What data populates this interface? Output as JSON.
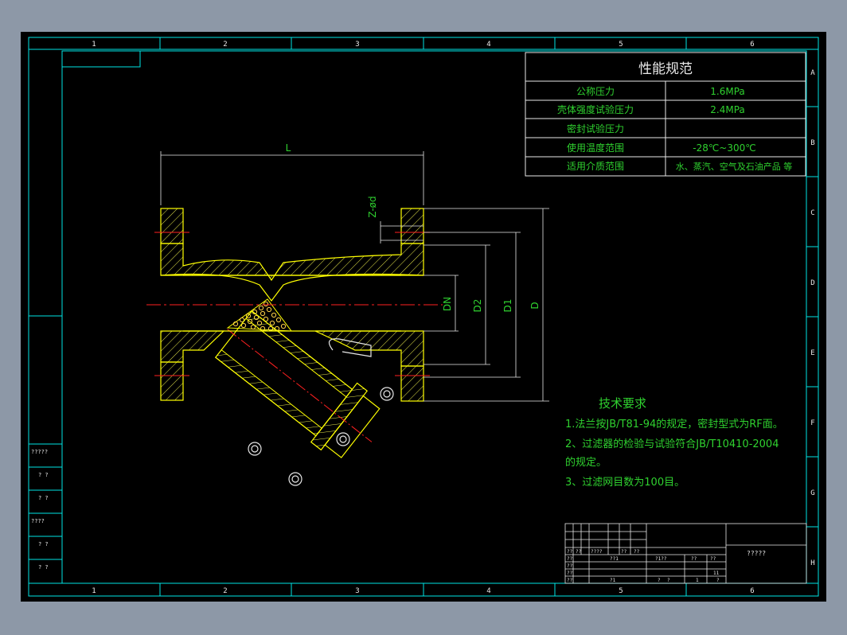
{
  "sheet": {
    "zone_columns": [
      "1",
      "2",
      "3",
      "4",
      "5",
      "6"
    ],
    "zone_rows": [
      "A",
      "B",
      "C",
      "D",
      "E",
      "F",
      "G",
      "H"
    ]
  },
  "performance_table": {
    "title": "性能规范",
    "rows": [
      {
        "label": "公称压力",
        "value": "1.6MPa"
      },
      {
        "label": "壳体强度试验压力",
        "value": "2.4MPa"
      },
      {
        "label": "密封试验压力",
        "value": ""
      },
      {
        "label": "使用温度范围",
        "value": "-28℃~300℃"
      },
      {
        "label": "适用介质范围",
        "value": "水、蒸汽、空气及石油产品 等"
      }
    ]
  },
  "dimensions": {
    "length": "L",
    "bolt_holes": "Z-ød",
    "nominal": "DN",
    "d2": "D2",
    "d1": "D1",
    "d": "D"
  },
  "technical_requirements": {
    "title": "技术要求",
    "items": [
      "1.法兰按JB/T81-94的规定，密封型式为RF面。",
      "2、过滤器的检验与试验符合JB/T10410-2004",
      "的规定。",
      "3、过滤网目数为100目。"
    ]
  },
  "revision_strip": [
    "?????",
    "? ?",
    "? ?",
    "????",
    "? ?",
    "? ?"
  ],
  "title_block": {
    "title_cell": "?????",
    "row_a": [
      "??",
      "??",
      "????",
      "??",
      "??"
    ],
    "row_b": [
      "??",
      "??1"
    ],
    "row_c": [
      "??",
      "?1??",
      "??",
      "??"
    ],
    "row_d": [
      "??",
      "11"
    ],
    "row_e": [
      "??",
      "?1",
      "?",
      "?",
      "1",
      "?"
    ]
  },
  "colors": {
    "frame": "#00e5e5",
    "text_primary": "#e8e8e8",
    "text_green": "#2fd12f",
    "outline": "#ffff00",
    "hatch": "#e8e84a",
    "centerline": "#ff2020",
    "mesh": "#ffd24a"
  }
}
